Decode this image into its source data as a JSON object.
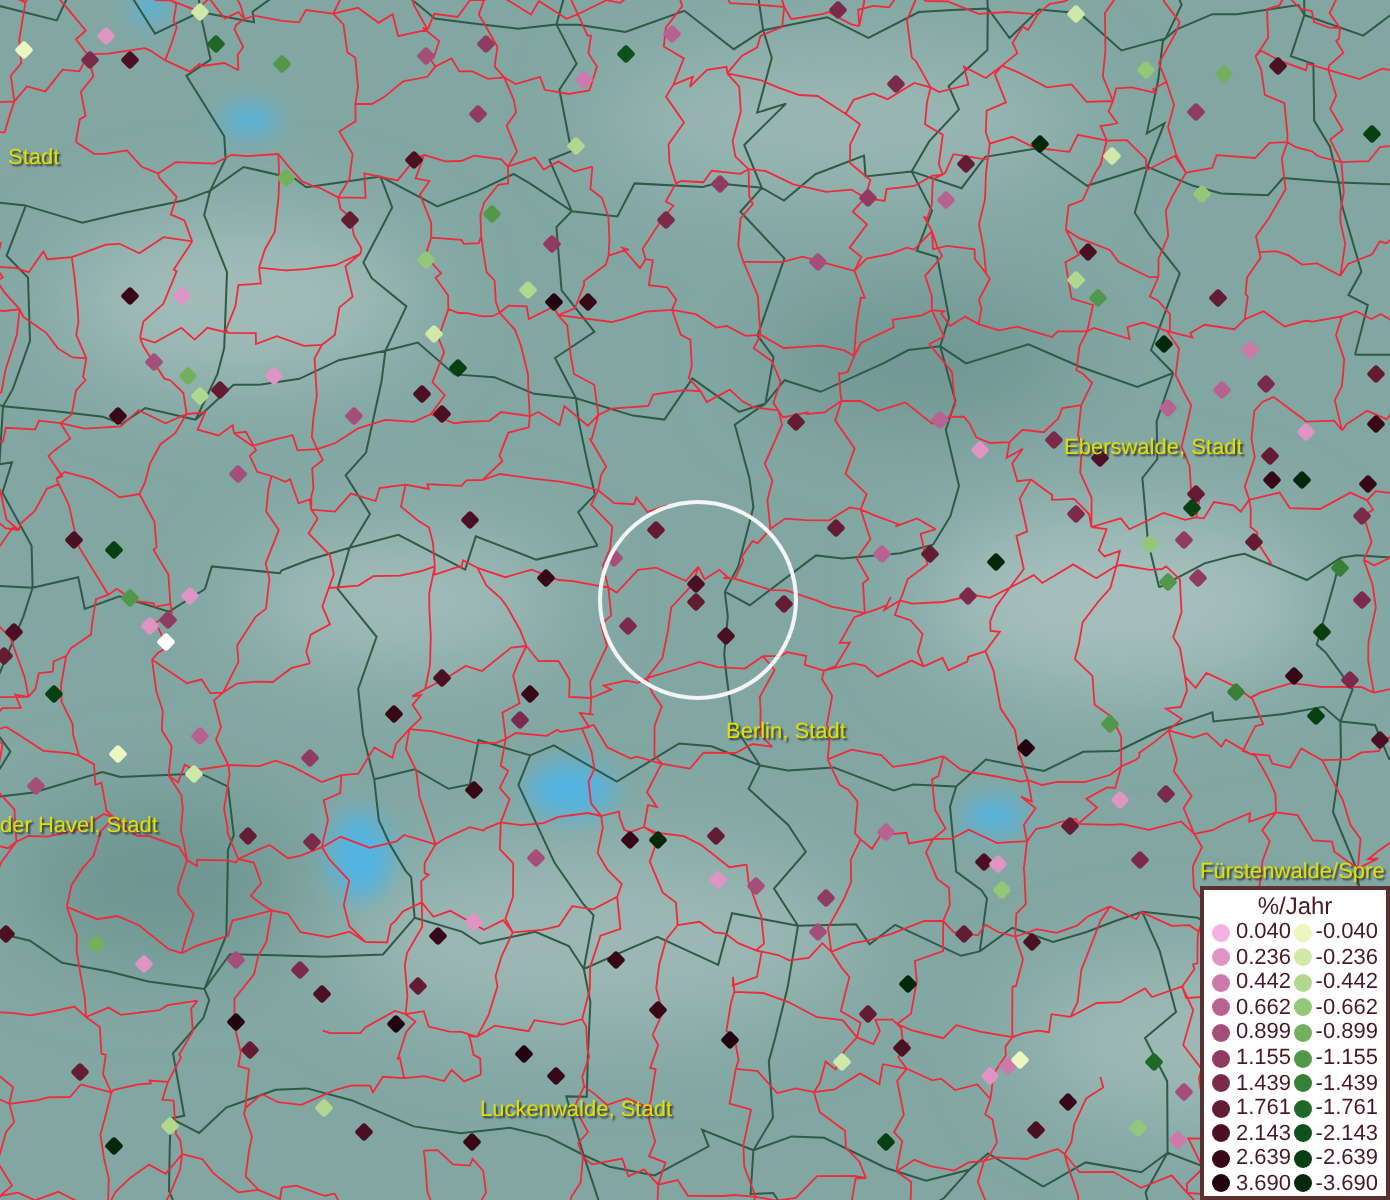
{
  "map": {
    "place_labels": [
      "Stadt",
      "Eberswalde, Stadt",
      "Berlin, Stadt",
      "der Havel, Stadt",
      "Luckenwalde, Stadt",
      "Fürstenwalde/Spre"
    ]
  },
  "legend": {
    "title": "%/Jahr",
    "rows": [
      {
        "positive": {
          "value": "0.040",
          "color": "#f4b2e2"
        },
        "negative": {
          "value": "-0.040",
          "color": "#eef6c0"
        }
      },
      {
        "positive": {
          "value": "0.236",
          "color": "#e094c4"
        },
        "negative": {
          "value": "-0.236",
          "color": "#d0e8a8"
        }
      },
      {
        "positive": {
          "value": "0.442",
          "color": "#cc7aaa"
        },
        "negative": {
          "value": "-0.442",
          "color": "#b2d890"
        }
      },
      {
        "positive": {
          "value": "0.662",
          "color": "#b86292"
        },
        "negative": {
          "value": "-0.662",
          "color": "#92c878"
        }
      },
      {
        "positive": {
          "value": "0.899",
          "color": "#a44e7a"
        },
        "negative": {
          "value": "-0.899",
          "color": "#72b060"
        }
      },
      {
        "positive": {
          "value": "1.155",
          "color": "#903c62"
        },
        "negative": {
          "value": "-1.155",
          "color": "#52984a"
        }
      },
      {
        "positive": {
          "value": "1.439",
          "color": "#7c2a4a"
        },
        "negative": {
          "value": "-1.439",
          "color": "#388038"
        }
      },
      {
        "positive": {
          "value": "1.761",
          "color": "#641c34"
        },
        "negative": {
          "value": "-1.761",
          "color": "#206828"
        }
      },
      {
        "positive": {
          "value": "2.143",
          "color": "#4c1024"
        },
        "negative": {
          "value": "-2.143",
          "color": "#10501c"
        }
      },
      {
        "positive": {
          "value": "2.639",
          "color": "#380818"
        },
        "negative": {
          "value": "-2.639",
          "color": "#084012"
        }
      },
      {
        "positive": {
          "value": "3.690",
          "color": "#220410"
        },
        "negative": {
          "value": "-3.690",
          "color": "#04280c"
        }
      }
    ]
  }
}
